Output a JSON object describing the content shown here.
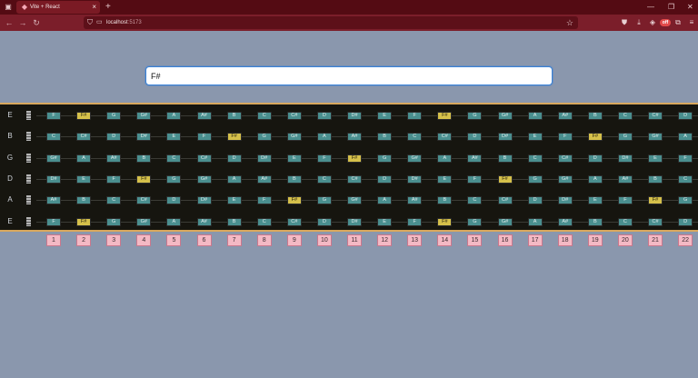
{
  "browser": {
    "tab_title": "Vite + React",
    "url_host": "localhost",
    "url_port": ":5173",
    "badge_label": "off"
  },
  "search": {
    "value": "F#",
    "placeholder": ""
  },
  "colors": {
    "note_normal": "#4a8f8f",
    "note_highlight": "#d5c04a",
    "fret_number_bg": "#f4b9c4",
    "fretboard_border": "#d9a85d"
  },
  "fretboard": {
    "highlighted_note": "F#",
    "strings": [
      {
        "label": "E",
        "notes": [
          "F",
          "F#",
          "G",
          "G#",
          "A",
          "A#",
          "B",
          "C",
          "C#",
          "D",
          "D#",
          "E",
          "F",
          "F#",
          "G",
          "G#",
          "A",
          "A#",
          "B",
          "C",
          "C#",
          "D"
        ]
      },
      {
        "label": "B",
        "notes": [
          "C",
          "C#",
          "D",
          "D#",
          "E",
          "F",
          "F#",
          "G",
          "G#",
          "A",
          "A#",
          "B",
          "C",
          "C#",
          "D",
          "D#",
          "E",
          "F",
          "F#",
          "G",
          "G#",
          "A"
        ]
      },
      {
        "label": "G",
        "notes": [
          "G#",
          "A",
          "A#",
          "B",
          "C",
          "C#",
          "D",
          "D#",
          "E",
          "F",
          "F#",
          "G",
          "G#",
          "A",
          "A#",
          "B",
          "C",
          "C#",
          "D",
          "D#",
          "E",
          "F"
        ]
      },
      {
        "label": "D",
        "notes": [
          "D#",
          "E",
          "F",
          "F#",
          "G",
          "G#",
          "A",
          "A#",
          "B",
          "C",
          "C#",
          "D",
          "D#",
          "E",
          "F",
          "F#",
          "G",
          "G#",
          "A",
          "A#",
          "B",
          "C"
        ]
      },
      {
        "label": "A",
        "notes": [
          "A#",
          "B",
          "C",
          "C#",
          "D",
          "D#",
          "E",
          "F",
          "F#",
          "G",
          "G#",
          "A",
          "A#",
          "B",
          "C",
          "C#",
          "D",
          "D#",
          "E",
          "F",
          "F#",
          "G"
        ]
      },
      {
        "label": "E",
        "notes": [
          "F",
          "F#",
          "G",
          "G#",
          "A",
          "A#",
          "B",
          "C",
          "C#",
          "D",
          "D#",
          "E",
          "F",
          "F#",
          "G",
          "G#",
          "A",
          "A#",
          "B",
          "C",
          "C#",
          "D"
        ]
      }
    ],
    "fret_numbers": [
      "1",
      "2",
      "3",
      "4",
      "5",
      "6",
      "7",
      "8",
      "9",
      "10",
      "11",
      "12",
      "13",
      "14",
      "15",
      "16",
      "17",
      "18",
      "19",
      "20",
      "21",
      "22"
    ]
  }
}
